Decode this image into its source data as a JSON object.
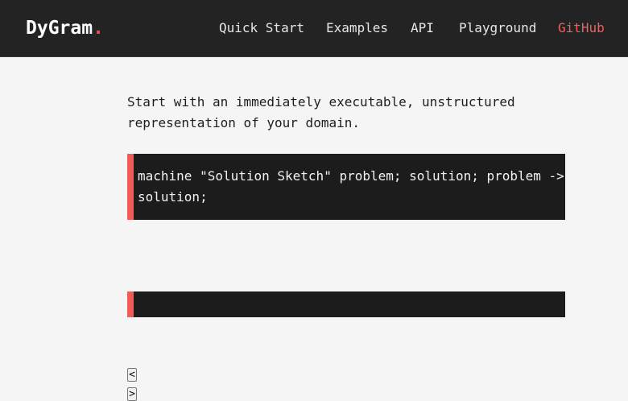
{
  "header": {
    "logo_text": "DyGram",
    "logo_dot": ".",
    "nav": {
      "quick_start": "Quick Start",
      "examples": "Examples",
      "api": "API",
      "playground": "Playground",
      "github": "GitHub"
    }
  },
  "main": {
    "intro": "Start with an immediately executable, unstructured representation of your domain.",
    "code_example": "machine \"Solution Sketch\" problem; solution; problem -> solution;",
    "output_block": ""
  },
  "pager": {
    "prev_label": "<",
    "next_label": ">"
  },
  "colors": {
    "header_bg": "#232323",
    "page_bg": "#f5f5f5",
    "accent": "#f25a55",
    "code_bg": "#1c1c1c"
  }
}
